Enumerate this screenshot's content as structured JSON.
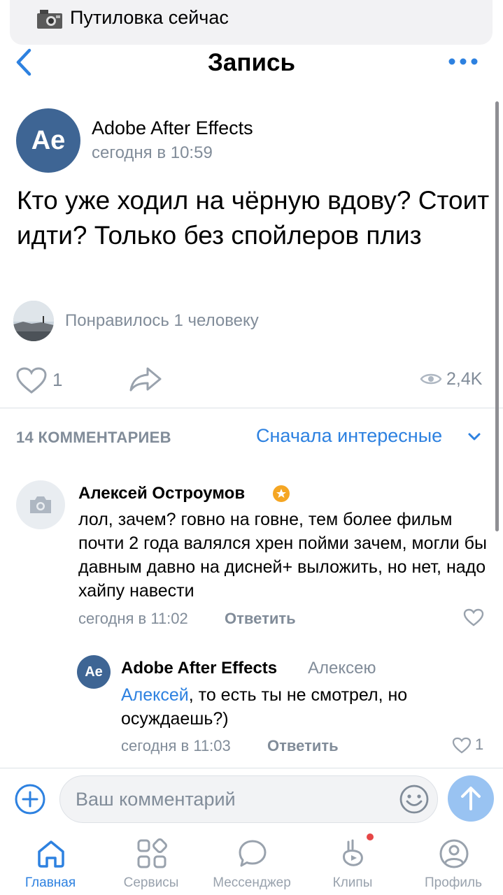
{
  "notification": {
    "icon": "camera-icon",
    "text": "Путиловка сейчас"
  },
  "header": {
    "title": "Запись",
    "back_icon": "chevron-left-icon",
    "more_icon": "more-dots-icon"
  },
  "post": {
    "avatar_text": "Ae",
    "author": "Adobe After Effects",
    "time": "сегодня в 10:59",
    "text": "Кто уже ходил на чёрную вдову? Стоит идти? Только без спойлеров плиз",
    "liked_by": "Понравилось 1 человеку",
    "likes": "1",
    "views": "2,4K"
  },
  "comments_section": {
    "count_label": "14 КОММЕНТАРИЕВ",
    "sort_label": "Сначала интересные"
  },
  "comments": [
    {
      "author": "Алексей Остроумов",
      "text": "лол, зачем? говно на говне, тем более фильм почти 2 года валялся хрен пойми зачем, могли бы давным давно на дисней+ выложить, но нет, надо хайпу навести",
      "time": "сегодня в 11:02",
      "reply_label": "Ответить"
    },
    {
      "avatar_text": "Ae",
      "author": "Adobe After Effects",
      "reply_to": "Алексею",
      "mention": "Алексей",
      "text": ", то есть ты не смотрел, но осуждаешь?)",
      "time": "сегодня в 11:03",
      "reply_label": "Ответить",
      "likes": "1"
    }
  ],
  "composer": {
    "placeholder": "Ваш комментарий"
  },
  "tabs": [
    {
      "label": "Главная",
      "icon": "home-icon",
      "active": true
    },
    {
      "label": "Сервисы",
      "icon": "services-icon",
      "active": false
    },
    {
      "label": "Мессенджер",
      "icon": "messenger-icon",
      "active": false
    },
    {
      "label": "Клипы",
      "icon": "clips-icon",
      "active": false
    },
    {
      "label": "Профиль",
      "icon": "profile-icon",
      "active": false
    }
  ],
  "colors": {
    "accent": "#2d81e0",
    "avatar_bg": "#3e6594",
    "secondary_text": "#818c99",
    "send_button": "#99c3f2"
  }
}
